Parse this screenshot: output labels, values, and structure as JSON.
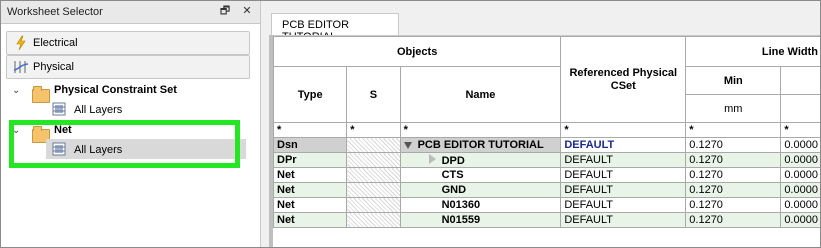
{
  "left_panel": {
    "title": "Worksheet Selector",
    "buttons": [
      {
        "label": "Electrical",
        "icon": "lightning-icon"
      },
      {
        "label": "Physical",
        "icon": "physical-icon"
      }
    ],
    "tree": [
      {
        "label": "Physical Constraint Set",
        "children": [
          "All Layers"
        ]
      },
      {
        "label": "Net",
        "children": [
          "All Layers"
        ]
      }
    ]
  },
  "right_panel": {
    "tab": "PCB EDITOR TUTORIAL",
    "headers": {
      "objects": "Objects",
      "referenced_cset": "Referenced Physical CSet",
      "line_width": "Line Width",
      "type": "Type",
      "s": "S",
      "name": "Name",
      "min": "Min",
      "mm": "mm"
    },
    "filter": [
      "*",
      "*",
      "*",
      "*",
      "*",
      "*"
    ],
    "rows": [
      {
        "type": "Dsn",
        "name": "PCB EDITOR TUTORIAL",
        "cset": "DEFAULT",
        "min": "0.1270",
        "next": "0.0000"
      },
      {
        "type": "DPr",
        "name": "DPD",
        "cset": "DEFAULT",
        "min": "0.1270",
        "next": "0.0000"
      },
      {
        "type": "Net",
        "name": "CTS",
        "cset": "DEFAULT",
        "min": "0.1270",
        "next": "0.0000"
      },
      {
        "type": "Net",
        "name": "GND",
        "cset": "DEFAULT",
        "min": "0.1270",
        "next": "0.0000"
      },
      {
        "type": "Net",
        "name": "N01360",
        "cset": "DEFAULT",
        "min": "0.1270",
        "next": "0.0000"
      },
      {
        "type": "Net",
        "name": "N01559",
        "cset": "DEFAULT",
        "min": "0.1270",
        "next": "0.0000"
      }
    ]
  }
}
